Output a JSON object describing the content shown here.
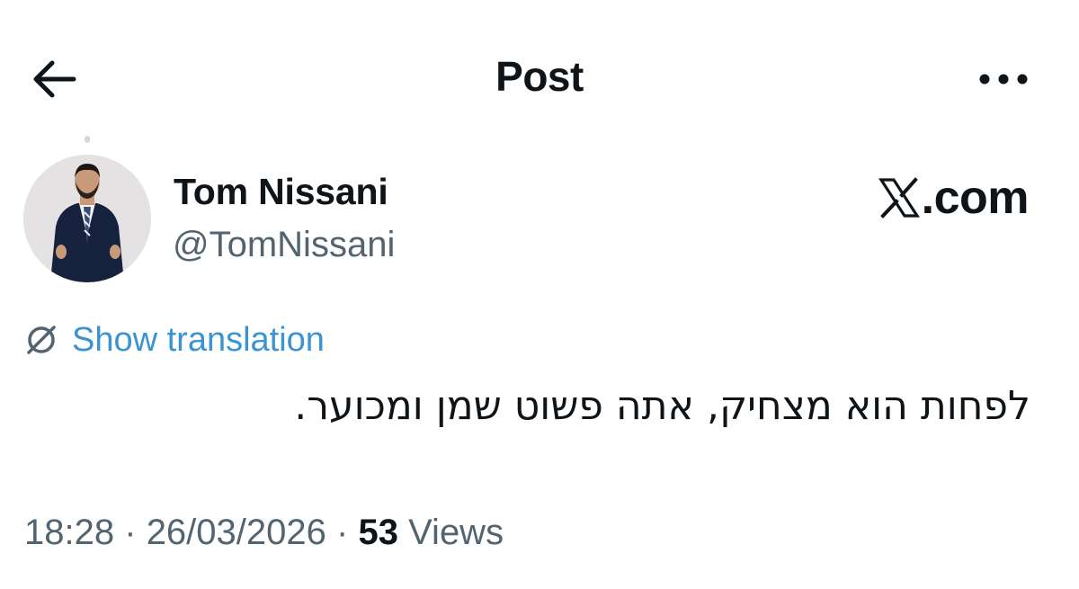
{
  "header": {
    "title": "Post",
    "back_icon": "arrow-left-icon",
    "more_icon": "more-horizontal-icon"
  },
  "author": {
    "display_name": "Tom Nissani",
    "handle": "@TomNissani",
    "avatar_icon": "profile-photo"
  },
  "watermark": {
    "logo_icon": "x-logo-icon",
    "text": ".com"
  },
  "translation": {
    "icon": "translate-globe-icon",
    "label": "Show translation"
  },
  "post": {
    "text": "לפחות הוא מצחיק, אתה פשוט שמן ומכוער."
  },
  "meta": {
    "time": "18:28",
    "separator": "·",
    "date": "26/03/2026",
    "views_count": "53",
    "views_label": "Views"
  },
  "colors": {
    "text_primary": "#0f1419",
    "text_secondary": "#536471",
    "link_blue": "#3b93d1",
    "background": "#ffffff"
  }
}
